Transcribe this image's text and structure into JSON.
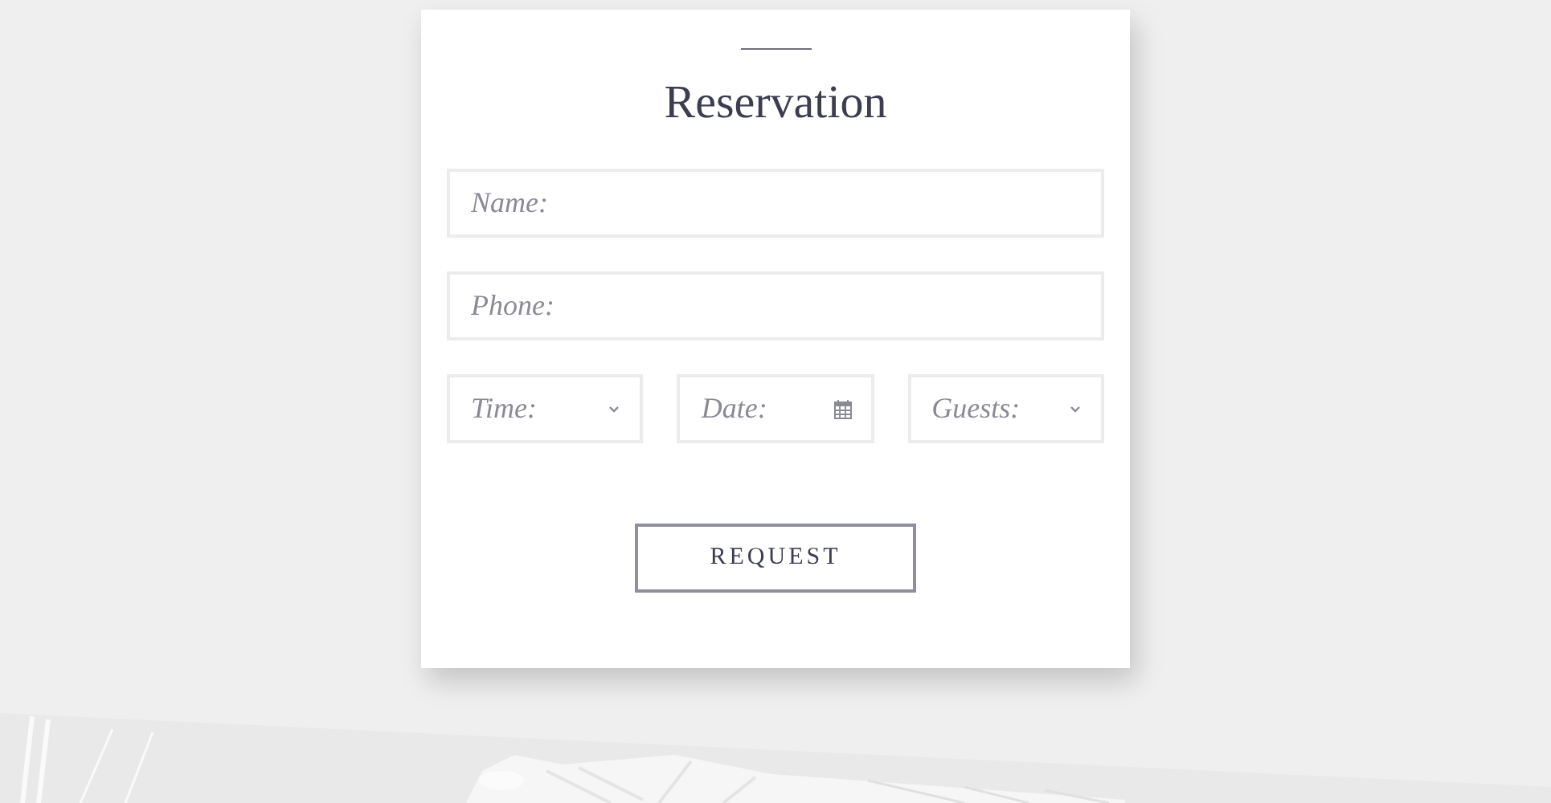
{
  "form": {
    "title": "Reservation",
    "fields": [
      {
        "kind": "text",
        "placeholder": "Name:"
      },
      {
        "kind": "text",
        "placeholder": "Phone:"
      }
    ],
    "row_fields": [
      {
        "kind": "select",
        "placeholder": "Time:"
      },
      {
        "kind": "date",
        "placeholder": "Date:"
      },
      {
        "kind": "select",
        "placeholder": "Guests:"
      }
    ],
    "button": "REQUEST"
  }
}
